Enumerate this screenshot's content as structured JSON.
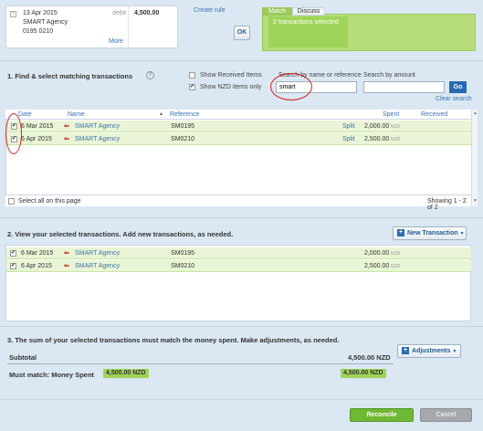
{
  "statement": {
    "date": "13 Apr 2015",
    "payee": "SMART Agency",
    "account": "0195 0210",
    "type": "debit",
    "amount": "4,500.00",
    "more": "More"
  },
  "create_rule": "Create rule",
  "ok_label": "OK",
  "tabs": {
    "match": "Match",
    "discuss": "Discuss"
  },
  "selection_status": "2 transactions selected",
  "find": {
    "heading": "1. Find & select matching transactions",
    "show_received": "Show Received Items",
    "show_nzd": "Show NZD items only",
    "search_label": "Search by name or reference",
    "search_value": "smart",
    "amount_label": "Search by amount",
    "amount_value": "",
    "go": "Go",
    "clear": "Clear search"
  },
  "results_table": {
    "columns": {
      "date": "Date",
      "name": "Name",
      "reference": "Reference",
      "spent": "Spent",
      "received": "Received"
    },
    "rows": [
      {
        "date": "6 Mar 2015",
        "name": "SMART Agency",
        "reference": "SM0195",
        "split": "Split",
        "spent": "2,000.00",
        "currency": "NZD"
      },
      {
        "date": "6 Apr 2015",
        "name": "SMART Agency",
        "reference": "SM0210",
        "split": "Split",
        "spent": "2,500.00",
        "currency": "NZD"
      }
    ],
    "select_all": "Select all on this page",
    "showing": "Showing 1 - 2 of 2"
  },
  "selected": {
    "heading": "2. View your selected transactions. Add new transactions, as needed.",
    "new_transaction": "New Transaction",
    "rows": [
      {
        "date": "6 Mar 2015",
        "name": "SMART Agency",
        "reference": "SM0195",
        "spent": "2,000.00",
        "currency": "NZD"
      },
      {
        "date": "6 Apr 2015",
        "name": "SMART Agency",
        "reference": "SM0210",
        "spent": "2,500.00",
        "currency": "NZD"
      }
    ]
  },
  "totals": {
    "heading": "3. The sum of your selected transactions must match the money spent. Make adjustments, as needed.",
    "adjustments": "Adjustments",
    "subtotal_label": "Subtotal",
    "subtotal_value": "4,500.00 NZD",
    "must_match_label": "Must match: Money Spent",
    "must_match_value": "4,500.00 NZD",
    "total_value": "4,500.00 NZD"
  },
  "actions": {
    "reconcile": "Reconcile",
    "cancel": "Cancel"
  },
  "colors": {
    "match_green": "#b5de7a",
    "link_blue": "#3b72b4",
    "reconcile_green": "#6fb834",
    "annotation_red": "#d21f1f"
  }
}
